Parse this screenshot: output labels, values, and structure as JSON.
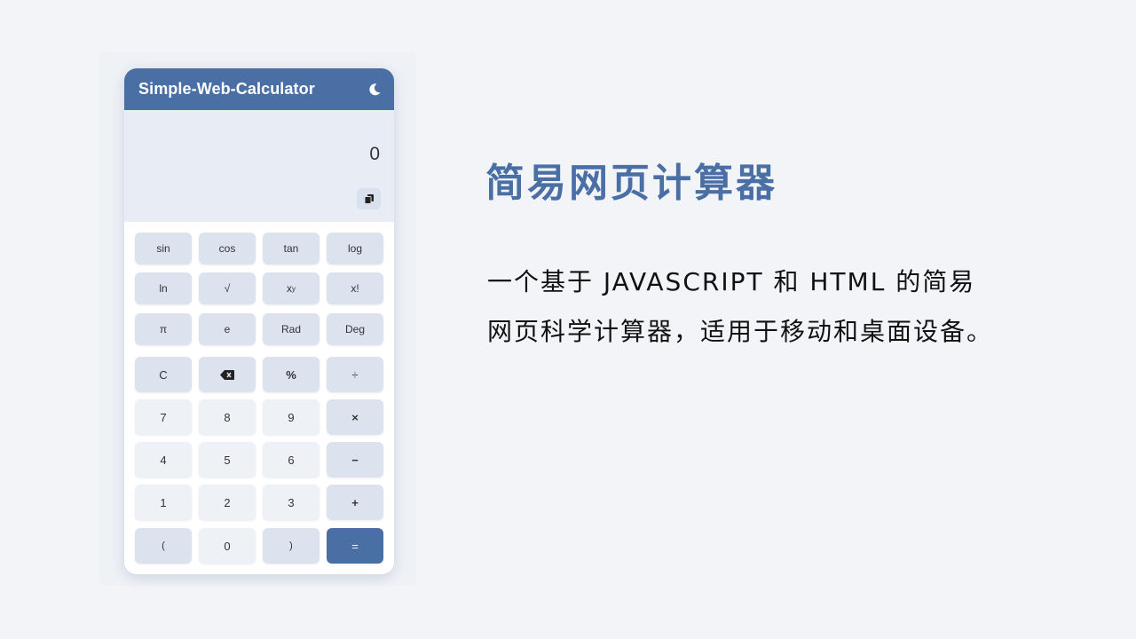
{
  "app": {
    "title": "Simple-Web-Calculator",
    "theme_toggle_icon": "moon-icon",
    "display_value": "0",
    "copy_icon": "copy-icon"
  },
  "keys": {
    "sin": "sin",
    "cos": "cos",
    "tan": "tan",
    "log": "log",
    "ln": "ln",
    "sqrt": "√",
    "pow_base": "x",
    "pow_exp": "y",
    "fact": "x!",
    "pi": "π",
    "e": "e",
    "rad": "Rad",
    "deg": "Deg",
    "clear": "C",
    "percent": "%",
    "divide": "÷",
    "seven": "7",
    "eight": "8",
    "nine": "9",
    "multiply": "×",
    "four": "4",
    "five": "5",
    "six": "6",
    "minus": "−",
    "one": "1",
    "two": "2",
    "three": "3",
    "plus": "+",
    "lparen": "(",
    "zero": "0",
    "rparen": ")",
    "equals": "="
  },
  "colors": {
    "accent": "#4a6fa5",
    "display_bg": "#e8edf5",
    "key_light": "#eef2f7",
    "key_dark": "#dce3ee"
  },
  "promo": {
    "title": "简易网页计算器",
    "line1": "一个基于 JAVASCRIPT 和 HTML 的简易",
    "line2": "网页科学计算器，适用于移动和桌面设备。"
  }
}
